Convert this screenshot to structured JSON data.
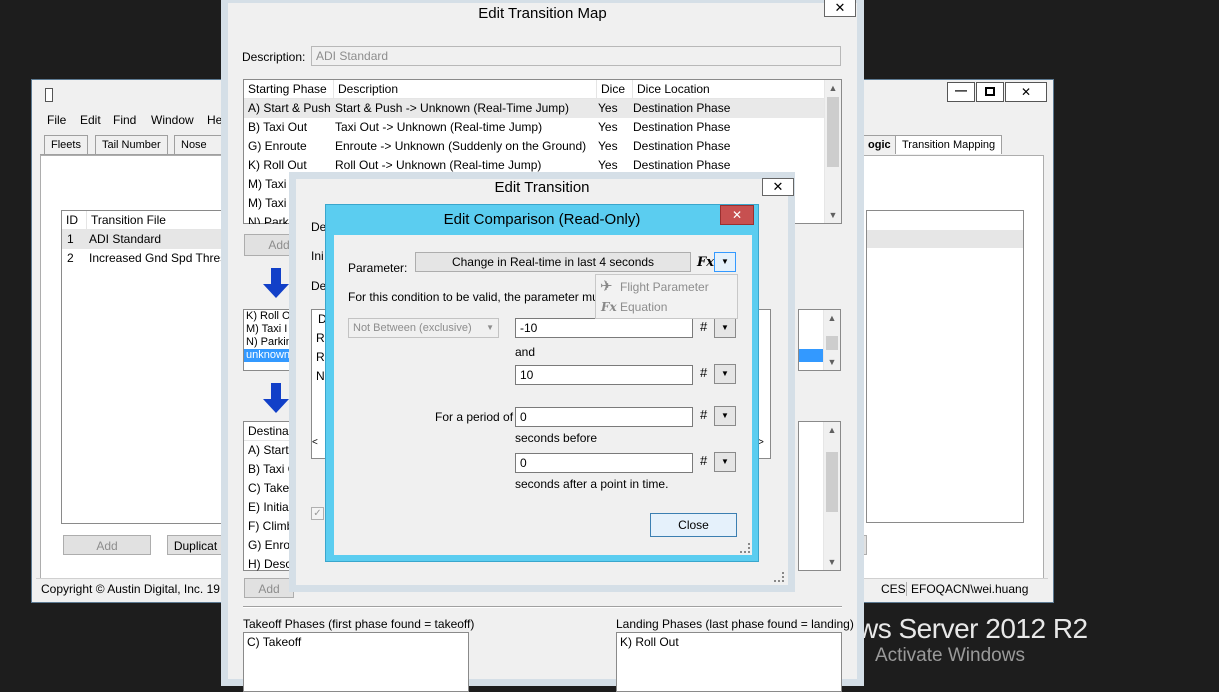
{
  "desktop": {
    "watermark_os": "ws Server 2012 R2",
    "watermark_activate": "Activate Windows"
  },
  "main_app": {
    "menu": [
      "File",
      "Edit",
      "Find",
      "Window",
      "He"
    ],
    "tabs_left": [
      "Fleets",
      "Tail Number",
      "Nose Nu"
    ],
    "tabs_right": [
      "ogic",
      "Transition Mapping"
    ],
    "columns": [
      "ID",
      "Transition File"
    ],
    "rows": [
      {
        "id": "1",
        "file": "ADI Standard"
      },
      {
        "id": "2",
        "file": "Increased Gnd Spd Thres"
      }
    ],
    "add_label": "Add",
    "duplicate_label": "Duplicat",
    "status_left": "Copyright © Austin Digital, Inc. 19",
    "status_ces": "CES",
    "status_user": "EFOQACN\\wei.huang"
  },
  "map_dialog": {
    "title": "Edit Transition Map",
    "description_label": "Description:",
    "description_value": "ADI Standard",
    "columns": [
      "Starting Phase",
      "Description",
      "Dice",
      "Dice Location"
    ],
    "rows": [
      {
        "phase": "A) Start & Push",
        "desc": "Start & Push -> Unknown (Real-Time Jump)",
        "dice": "Yes",
        "loc": "Destination Phase"
      },
      {
        "phase": "B) Taxi Out",
        "desc": "Taxi Out -> Unknown (Real-time Jump)",
        "dice": "Yes",
        "loc": "Destination Phase"
      },
      {
        "phase": "G) Enroute",
        "desc": "Enroute -> Unknown (Suddenly on the Ground)",
        "dice": "Yes",
        "loc": "Destination Phase"
      },
      {
        "phase": "K) Roll Out",
        "desc": "Roll Out -> Unknown (Real-time Jump)",
        "dice": "Yes",
        "loc": "Destination Phase"
      },
      {
        "phase": "M) Taxi",
        "desc": "",
        "dice": "",
        "loc": ""
      },
      {
        "phase": "M) Taxi",
        "desc": "",
        "dice": "",
        "loc": ""
      },
      {
        "phase": "N) Parki",
        "desc": "",
        "dice": "",
        "loc": ""
      }
    ],
    "add_label": "Add",
    "mid_list": [
      "K) Roll Ou",
      "M) Taxi I",
      "N) Parkin",
      "unknown"
    ],
    "dest_header": "Destina",
    "dest_list": [
      "A) Start",
      "B) Taxi O",
      "C) Take",
      "E) Initial",
      "F) Climb",
      "G) Enro",
      "H) Desc"
    ],
    "add2_label": "Add",
    "takeoff_label": "Takeoff Phases (first phase found = takeoff)",
    "takeoff_items": [
      "C) Takeoff"
    ],
    "landing_label": "Landing Phases (last phase found = landing)",
    "landing_items": [
      "K) Roll Out"
    ]
  },
  "transition_dialog": {
    "title": "Edit Transition",
    "labels": [
      "De",
      "Ini",
      "De"
    ],
    "list_header": "D",
    "list_rows": [
      "R",
      "R",
      "N"
    ]
  },
  "comparison_dialog": {
    "title": "Edit Comparison (Read-Only)",
    "parameter_label": "Parameter:",
    "parameter_value": "Change in Real-time in last 4 seconds",
    "fx_label": "Fx",
    "condition_text": "For this condition to be valid, the parameter must b",
    "operator_value": "Not Between (exclusive)",
    "value1": "-10",
    "and_label": "and",
    "value2": "10",
    "period_label": "For a period of",
    "period_value": "0",
    "seconds_before": "seconds before",
    "after_value": "0",
    "seconds_after": "seconds after a point in time.",
    "close_label": "Close",
    "menu_items": [
      {
        "label": "Flight Parameter",
        "icon": "airplane-icon"
      },
      {
        "label": "Equation",
        "icon": "fx-icon"
      }
    ]
  },
  "colors": {
    "aero_blue": "#5bcdf0",
    "close_red": "#c75050",
    "selection": "#3399ff"
  }
}
